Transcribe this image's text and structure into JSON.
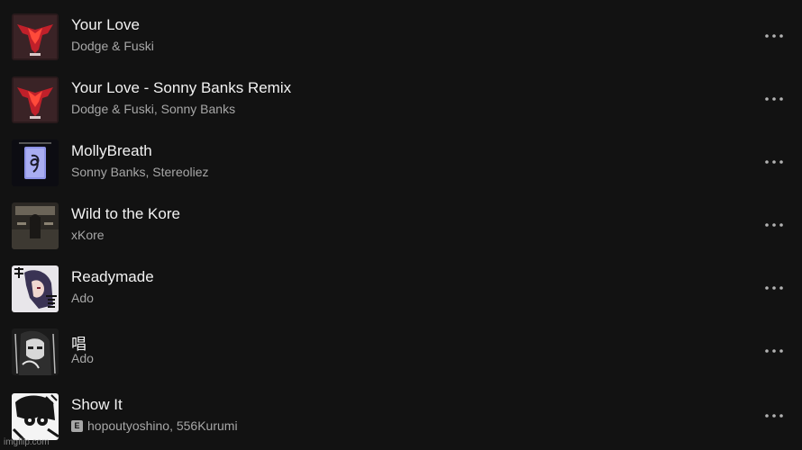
{
  "tracks": [
    {
      "title": "Your Love",
      "artists": "Dodge & Fuski",
      "explicit": false,
      "cover_icon": "red-bird-art"
    },
    {
      "title": "Your Love - Sonny Banks Remix",
      "artists": "Dodge & Fuski, Sonny Banks",
      "explicit": false,
      "cover_icon": "red-bird-art"
    },
    {
      "title": "MollyBreath",
      "artists": "Sonny Banks, Stereoliez",
      "explicit": false,
      "cover_icon": "blue-card-art"
    },
    {
      "title": "Wild to the Kore",
      "artists": "xKore",
      "explicit": false,
      "cover_icon": "dark-figure-art"
    },
    {
      "title": "Readymade",
      "artists": "Ado",
      "explicit": false,
      "cover_icon": "anime-kanji-art"
    },
    {
      "title": "唱",
      "artists": "Ado",
      "explicit": false,
      "cover_icon": "monochrome-anime-art"
    },
    {
      "title": "Show It",
      "artists": "hopoutyoshino, 556Kurumi",
      "explicit": true,
      "cover_icon": "manga-art"
    }
  ],
  "explicit_label": "E",
  "more_icon": "ellipsis-icon",
  "watermark": "imgflip.com",
  "colors": {
    "background": "#121212",
    "title": "#f2f2f2",
    "subtitle": "#a7a7a7"
  }
}
